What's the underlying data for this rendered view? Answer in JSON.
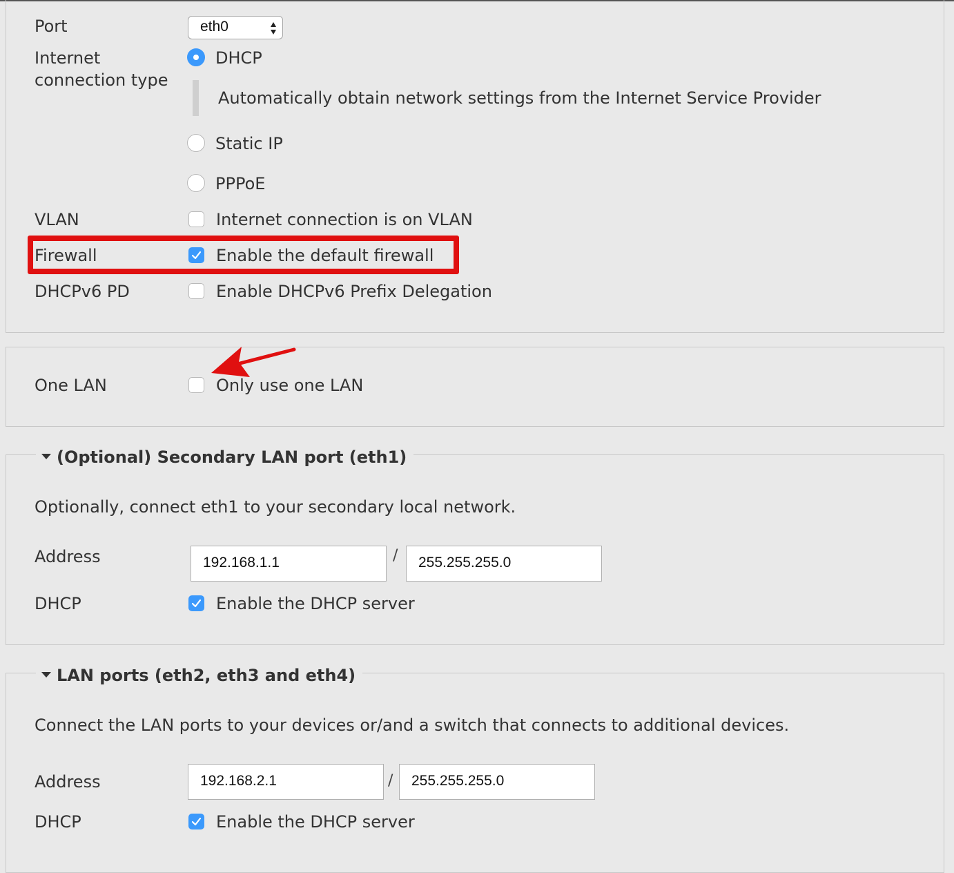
{
  "wan": {
    "port": {
      "label": "Port",
      "value": "eth0"
    },
    "connection_type": {
      "label_line1": "Internet",
      "label_line2": "connection type",
      "options": [
        {
          "label": "DHCP",
          "selected": true
        },
        {
          "label": "Static IP",
          "selected": false
        },
        {
          "label": "PPPoE",
          "selected": false
        }
      ],
      "dhcp_description": "Automatically obtain network settings from the Internet Service Provider"
    },
    "vlan": {
      "label": "VLAN",
      "option": "Internet connection is on VLAN",
      "checked": false
    },
    "firewall": {
      "label": "Firewall",
      "option": "Enable the default firewall",
      "checked": true
    },
    "dhcpv6": {
      "label": "DHCPv6 PD",
      "option": "Enable DHCPv6 Prefix Delegation",
      "checked": false
    }
  },
  "one_lan": {
    "label": "One LAN",
    "option": "Only use one LAN",
    "checked": false
  },
  "secondary_lan": {
    "legend": "(Optional) Secondary LAN port (eth1)",
    "description": "Optionally, connect eth1 to your secondary local network.",
    "address_label": "Address",
    "address": "192.168.1.1",
    "separator": "/",
    "netmask": "255.255.255.0",
    "dhcp_label": "DHCP",
    "dhcp_option": "Enable the DHCP server",
    "dhcp_checked": true
  },
  "lan_ports": {
    "legend": "LAN ports (eth2, eth3 and eth4)",
    "description": "Connect the LAN ports to your devices or/and a switch that connects to additional devices.",
    "address_label": "Address",
    "address": "192.168.2.1",
    "separator": "/",
    "netmask": "255.255.255.0",
    "dhcp_label": "DHCP",
    "dhcp_option": "Enable the DHCP server",
    "dhcp_checked": true
  },
  "annotation": {
    "highlight_color": "#e01010",
    "accent": "#3b99fc"
  }
}
